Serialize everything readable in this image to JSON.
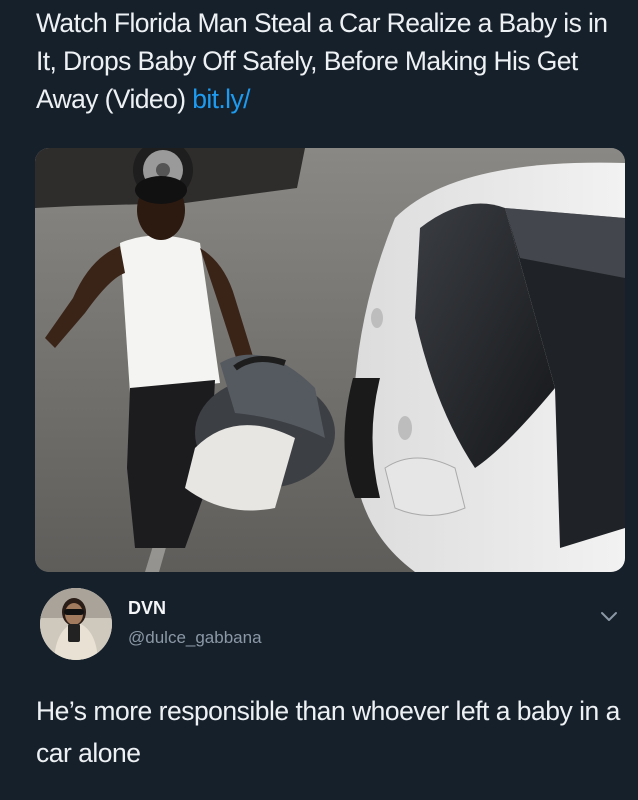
{
  "header": {
    "headline": "Watch Florida Man Steal a Car Realize a Baby is in It, Drops Baby Off Safely, Before Making His Get Away (Video)",
    "link_text": "bit.ly/"
  },
  "media": {
    "description_icon": "photo-man-carrying-baby-seat-by-car"
  },
  "tweet": {
    "display_name": "DVN",
    "handle": "@dulce_gabbana",
    "text": "He’s more responsible than whoever left a baby in a car alone"
  },
  "colors": {
    "background": "#16202b",
    "link": "#1d9bf0",
    "secondary_text": "#8b98a5"
  }
}
